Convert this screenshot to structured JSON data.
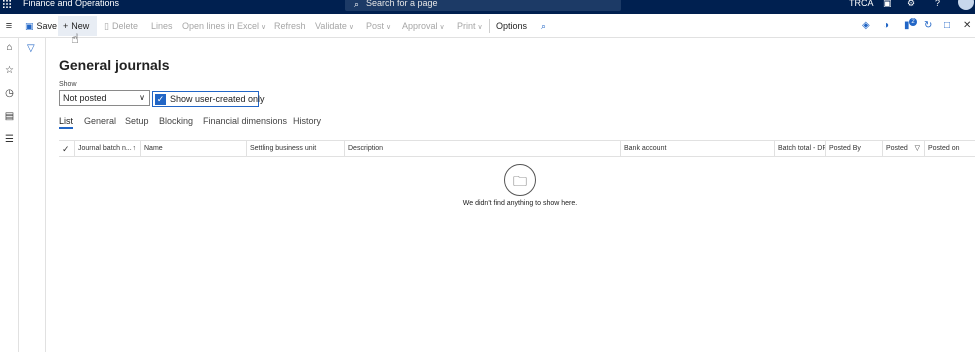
{
  "topbar": {
    "app_title": "Finance and Operations",
    "search_placeholder": "Search for a page",
    "company": "TRCA",
    "icons": [
      "waffle-icon",
      "search-icon",
      "chat-icon",
      "gear-icon",
      "help-icon",
      "avatar"
    ]
  },
  "actionbar": {
    "items": [
      {
        "label": "Save",
        "icon": "save-icon",
        "enabled": true
      },
      {
        "label": "New",
        "icon": "plus-icon",
        "enabled": true
      },
      {
        "label": "Delete",
        "icon": "trash-icon",
        "enabled": false
      },
      {
        "label": "Lines",
        "enabled": false
      },
      {
        "label": "Open lines in Excel",
        "enabled": false,
        "dropdown": true
      },
      {
        "label": "Refresh",
        "enabled": false
      },
      {
        "label": "Validate",
        "enabled": false,
        "dropdown": true
      },
      {
        "label": "Post",
        "enabled": false,
        "dropdown": true
      },
      {
        "label": "Approval",
        "enabled": false,
        "dropdown": true
      },
      {
        "label": "Print",
        "enabled": false,
        "dropdown": true
      },
      {
        "label": "Options",
        "enabled": true
      }
    ],
    "notification_count": "2"
  },
  "page": {
    "title": "General journals",
    "show_label": "Show",
    "show_value": "Not posted",
    "user_created_label": "Show user-created only",
    "user_created_checked": true
  },
  "tabs": [
    "List",
    "General",
    "Setup",
    "Blocking",
    "Financial dimensions",
    "History"
  ],
  "grid": {
    "columns": [
      "Journal batch n...",
      "Name",
      "Settling business unit",
      "Description",
      "Bank account",
      "Batch total - DR",
      "Posted By",
      "Posted",
      "Posted on"
    ],
    "empty_message": "We didn't find anything to show here."
  },
  "colors": {
    "nav": "#002050",
    "accent": "#2266c6"
  }
}
